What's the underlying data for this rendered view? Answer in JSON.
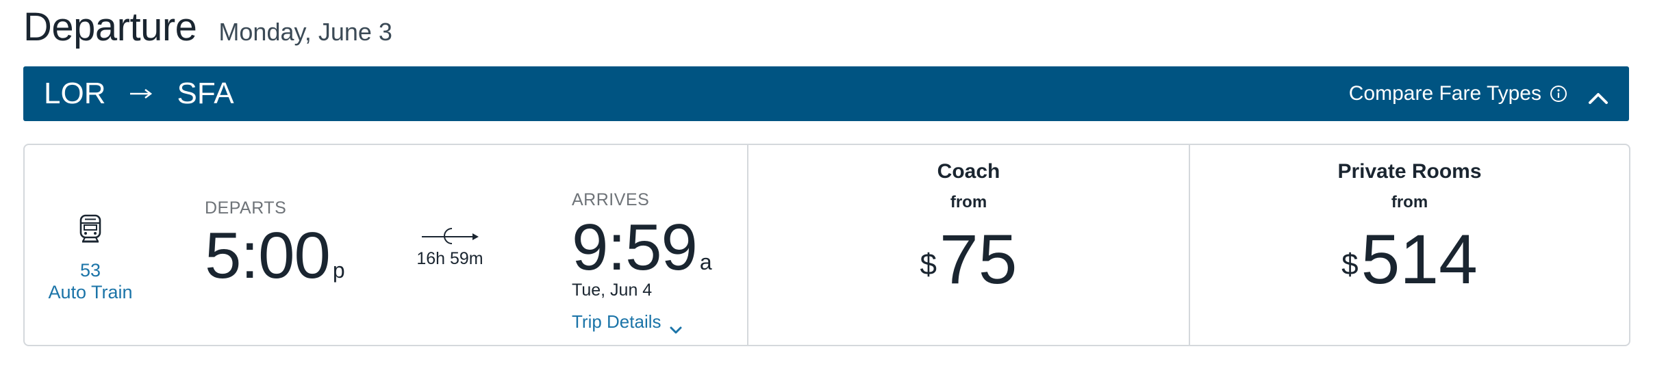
{
  "header": {
    "title": "Departure",
    "date": "Monday, June 3"
  },
  "route": {
    "origin": "LOR",
    "destination": "SFA",
    "compare_label": "Compare Fare Types",
    "background_color": "#005482"
  },
  "train": {
    "number": "53",
    "name": "Auto Train",
    "icon": "train-icon"
  },
  "departure": {
    "label": "DEPARTS",
    "time": "5:00",
    "period": "p"
  },
  "duration": {
    "text": "16h 59m",
    "icon": "overnight-moon-arrow-icon"
  },
  "arrival": {
    "label": "ARRIVES",
    "time": "9:59",
    "period": "a",
    "date": "Tue, Jun 4"
  },
  "trip_details": {
    "label": "Trip Details"
  },
  "fares": [
    {
      "name": "Coach",
      "from_label": "from",
      "currency": "$",
      "price": "75"
    },
    {
      "name": "Private Rooms",
      "from_label": "from",
      "currency": "$",
      "price": "514"
    }
  ],
  "colors": {
    "primary_blue": "#005482",
    "link_blue": "#1b74a8",
    "text_dark": "#1a2530",
    "text_muted": "#6e7378",
    "border": "#d4d8dc"
  }
}
